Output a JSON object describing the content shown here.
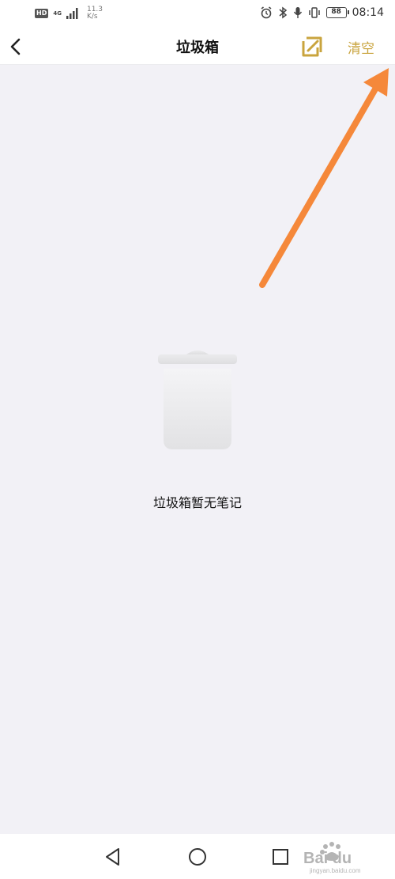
{
  "status_bar": {
    "hd": "HD",
    "network": "4G",
    "speed_value": "11.3",
    "speed_unit": "K/s",
    "battery": "88",
    "time": "08:14"
  },
  "header": {
    "title": "垃圾箱",
    "clear_label": "清空"
  },
  "empty_state": {
    "message": "垃圾箱暂无笔记"
  },
  "colors": {
    "accent": "#c9a43e",
    "arrow": "#f5883a",
    "background": "#f2f1f6"
  },
  "icons": [
    "back-chevron-icon",
    "edit-note-icon",
    "trash-can-icon",
    "nav-back-icon",
    "nav-home-icon",
    "nav-recent-icon"
  ],
  "watermark": {
    "brand": "Bai du",
    "site": "jingyan.baidu.com"
  }
}
